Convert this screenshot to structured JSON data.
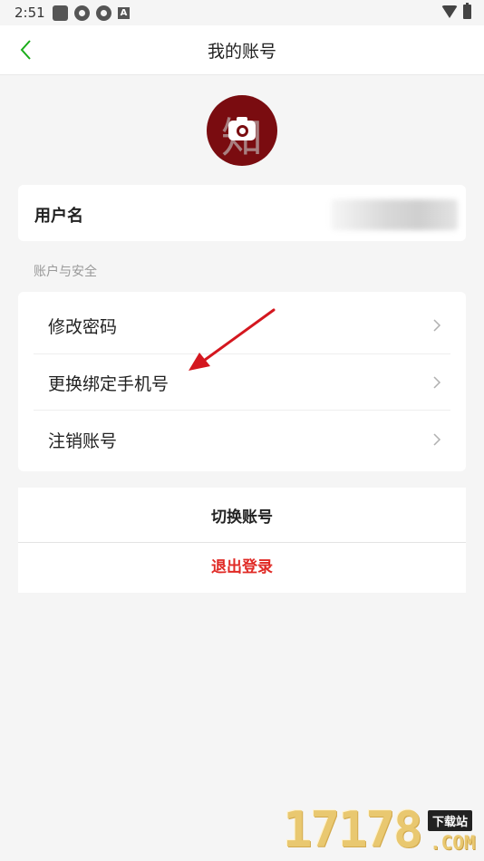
{
  "status_bar": {
    "time": "2:51",
    "notification_icons": [
      "app-square-icon",
      "aperture-icon",
      "aperture-icon",
      "a-badge-icon"
    ],
    "a_badge": "A",
    "right_icons": [
      "wifi-icon",
      "battery-icon"
    ]
  },
  "header": {
    "title": "我的账号",
    "back_icon": "chevron-left-icon"
  },
  "profile": {
    "avatar_glyph": "知",
    "avatar_icons": [
      "camera-icon"
    ]
  },
  "user_card": {
    "label": "用户名"
  },
  "section_label": "账户与安全",
  "security_items": [
    {
      "label": "修改密码",
      "icon": "chevron-right-icon"
    },
    {
      "label": "更换绑定手机号",
      "icon": "chevron-right-icon"
    },
    {
      "label": "注销账号",
      "icon": "chevron-right-icon"
    }
  ],
  "actions": {
    "switch_account": "切换账号",
    "logout": "退出登录"
  },
  "watermark": {
    "number": "17178",
    "tag": "下载站",
    "domain": ".COM"
  },
  "colors": {
    "accent_green": "#1aad19",
    "logout_red": "#e02a25",
    "annotation_red": "#d4171f",
    "avatar_bg": "#7a0c10",
    "page_bg": "#f5f5f5"
  }
}
